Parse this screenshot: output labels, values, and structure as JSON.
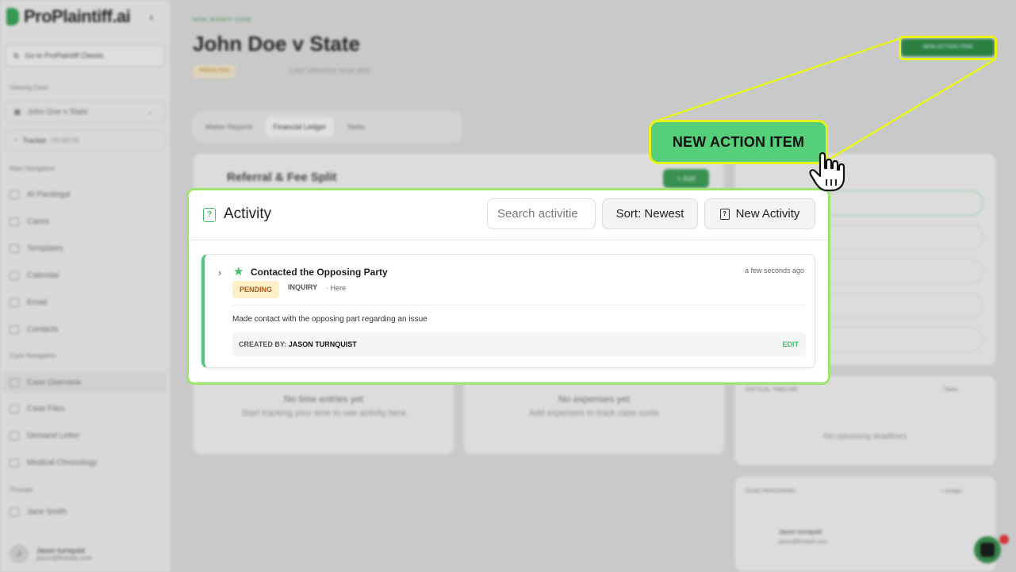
{
  "app": {
    "logo_text": "ProPlaintiff.ai",
    "classic_link": "Go to ProPlaintiff Classic",
    "viewing_case_label": "Viewing Case",
    "case_select": "John Doe v State",
    "tracker_label": "Tracker",
    "tracker_time": "00:00:00",
    "main_nav_label": "Main Navigation",
    "main_nav": [
      "AI Paralegal",
      "Cases",
      "Templates",
      "Calendar",
      "Email",
      "Contacts"
    ],
    "case_nav_label": "Case Navigation",
    "case_nav": [
      "Case Overview",
      "Case Files",
      "Demand Letter",
      "Medical Chronology"
    ],
    "threads_label": "Threads",
    "thread_item": "Jane Smith",
    "user_name": "Jason turnquist",
    "user_email": "jason@firstsite.com"
  },
  "page": {
    "breadcrumb": "NEW JERSEY CASE",
    "title": "John Doe v State",
    "status_pill": "PREFILTER",
    "updated": "LAST UPDATED 11/14 2025",
    "top_button": "NEW ACTION ITEM",
    "tabs": [
      "Matter Reports",
      "Financial Ledger",
      "Tasks"
    ],
    "referral_title": "Referral & Fee Split",
    "referral_add": "+ Add",
    "time_empty_title": "No time entries yet",
    "time_empty_sub": "Start tracking your time to see activity here",
    "exp_empty_title": "No expenses yet",
    "exp_empty_sub": "Add expenses to track case costs",
    "timeline_label": "CRITICAL TIMELINE",
    "timeline_tasks": "Tasks",
    "timeline_empty": "No upcoming deadlines",
    "personnel_label": "CASE PERSONNEL",
    "personnel_assign": "+ Assign",
    "personnel_name": "Jason turnquist",
    "personnel_email": "jason@firstsite.com"
  },
  "activity": {
    "title": "Activity",
    "search_placeholder": "Search activitie",
    "sort_label": "Sort: Newest",
    "new_label": "New Activity",
    "items": [
      {
        "title": "Contacted the Opposing Party",
        "time": "a few seconds ago",
        "status": "PENDING",
        "type": "INQUIRY",
        "location": "· Here",
        "description": "Made contact with the opposing part regarding an issue",
        "created_by_label": "CREATED BY:",
        "created_by": "JASON TURNQUIST",
        "edit_label": "EDIT"
      }
    ]
  },
  "callout": {
    "text": "NEW ACTION ITEM"
  },
  "colors": {
    "accent_green": "#55cf79",
    "highlight_yellow": "#e6f41a",
    "pending_bg": "#fdf0c8",
    "pending_text": "#b2591a"
  }
}
